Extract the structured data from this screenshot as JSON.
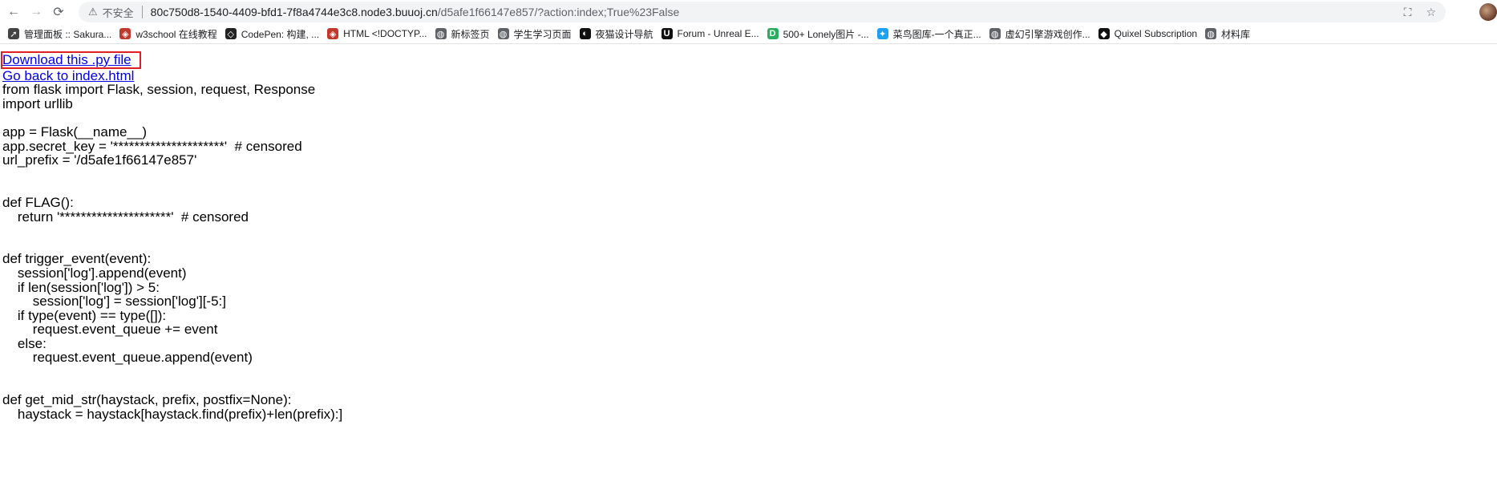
{
  "browser": {
    "nav": {
      "back": "←",
      "forward": "→",
      "reload": "⟳"
    },
    "omnibox": {
      "warning_icon": "⚠",
      "insecure_label": "不安全",
      "host": "80c750d8-1540-4409-bfd1-7f8a4744e3c8.node3.buuoj.cn",
      "path": "/d5afe1f66147e857/?action:index;True%23False"
    },
    "right_icons": {
      "translate": "⛶",
      "star": "☆"
    }
  },
  "bookmarks": [
    {
      "label": "管理面板 :: Sakura...",
      "icon": "rocket-icon",
      "color": "#444444",
      "glyph": "➚"
    },
    {
      "label": "w3school 在线教程",
      "icon": "w3school-icon",
      "color": "#c0392b",
      "glyph": "◈"
    },
    {
      "label": "CodePen: 构建, ...",
      "icon": "codepen-icon",
      "color": "#222222",
      "glyph": "◇"
    },
    {
      "label": "HTML <!DOCTYP...",
      "icon": "w3school-icon",
      "color": "#c0392b",
      "glyph": "◈"
    },
    {
      "label": "新标签页",
      "icon": "globe-icon",
      "color": "#5f6368",
      "glyph": "◍"
    },
    {
      "label": "学生学习页面",
      "icon": "globe-icon",
      "color": "#5f6368",
      "glyph": "◍"
    },
    {
      "label": "夜猫设计导航",
      "icon": "cat-icon",
      "color": "#111111",
      "glyph": "◐"
    },
    {
      "label": "Forum - Unreal E...",
      "icon": "unreal-icon",
      "color": "#111111",
      "glyph": "U"
    },
    {
      "label": "500+ Lonely图片 -...",
      "icon": "lonely-icon",
      "color": "#27ae60",
      "glyph": "D"
    },
    {
      "label": "菜鸟图库-一个真正...",
      "icon": "bird-icon",
      "color": "#1da1f2",
      "glyph": "✦"
    },
    {
      "label": "虚幻引擎游戏创作...",
      "icon": "globe-icon",
      "color": "#5f6368",
      "glyph": "◍"
    },
    {
      "label": "Quixel Subscription",
      "icon": "quixel-icon",
      "color": "#111111",
      "glyph": "◆"
    },
    {
      "label": "材料库",
      "icon": "globe-icon",
      "color": "#5f6368",
      "glyph": "◍"
    }
  ],
  "page": {
    "download_link": "Download this .py file",
    "back_link": "Go back to index.html",
    "code_lines": [
      "from flask import Flask, session, request, Response",
      "import urllib",
      "",
      "app = Flask(__name__)",
      "app.secret_key = '*********************'  # censored",
      "url_prefix = '/d5afe1f66147e857'",
      "",
      "",
      "def FLAG():",
      "    return '*********************'  # censored",
      "",
      "",
      "def trigger_event(event):",
      "    session['log'].append(event)",
      "    if len(session['log']) > 5:",
      "        session['log'] = session['log'][-5:]",
      "    if type(event) == type([]):",
      "        request.event_queue += event",
      "    else:",
      "        request.event_queue.append(event)",
      "",
      "",
      "def get_mid_str(haystack, prefix, postfix=None):",
      "    haystack = haystack[haystack.find(prefix)+len(prefix):]"
    ]
  }
}
